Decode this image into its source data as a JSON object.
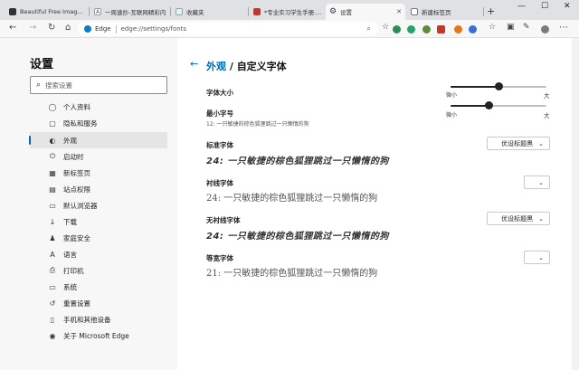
{
  "tabs": [
    {
      "label": "Beautiful Free Images &",
      "active": false
    },
    {
      "label": "一周速抄-互联网精彩内",
      "active": false
    },
    {
      "label": "收藏夹",
      "active": false
    },
    {
      "label": "*专业实习学生手册.pdf",
      "active": false
    },
    {
      "label": "设置",
      "active": true
    },
    {
      "label": "新建标签页",
      "active": false
    }
  ],
  "toolbar": {
    "brand": "Edge",
    "url": "edge://settings/fonts"
  },
  "sidebar": {
    "title": "设置",
    "search_placeholder": "搜索设置",
    "items": [
      {
        "label": "个人资料",
        "icon": "person-icon"
      },
      {
        "label": "隐私和服务",
        "icon": "lock-icon"
      },
      {
        "label": "外观",
        "icon": "appearance-icon",
        "active": true
      },
      {
        "label": "启动时",
        "icon": "power-icon"
      },
      {
        "label": "新标签页",
        "icon": "newtab-icon"
      },
      {
        "label": "站点权限",
        "icon": "permissions-icon"
      },
      {
        "label": "默认浏览器",
        "icon": "browser-icon"
      },
      {
        "label": "下载",
        "icon": "download-icon"
      },
      {
        "label": "家庭安全",
        "icon": "family-icon"
      },
      {
        "label": "语言",
        "icon": "language-icon"
      },
      {
        "label": "打印机",
        "icon": "printer-icon"
      },
      {
        "label": "系统",
        "icon": "system-icon"
      },
      {
        "label": "重置设置",
        "icon": "reset-icon"
      },
      {
        "label": "手机和其他设备",
        "icon": "phone-icon"
      },
      {
        "label": "关于 Microsoft Edge",
        "icon": "edge-logo-icon"
      }
    ]
  },
  "main": {
    "breadcrumb_parent": "外观",
    "breadcrumb_sep": " / ",
    "breadcrumb_current": "自定义字体",
    "font_size": {
      "label": "字体大小",
      "min_label": "微小",
      "max_label": "大",
      "value_fraction": 0.5
    },
    "min_font_size": {
      "label": "最小字号",
      "sample": "12: 一只敏捷的棕色狐狸跳过一只懒惰的狗",
      "min_label": "微小",
      "max_label": "大",
      "value_fraction": 0.4
    },
    "standard_font": {
      "label": "标准字体",
      "sample": "24: 一只敏捷的棕色狐狸跳过一只懒惰的狗",
      "selected": "优设标题黑"
    },
    "serif_font": {
      "label": "衬线字体",
      "sample": "24: 一只敏捷的棕色狐狸跳过一只懒惰的狗",
      "selected": ""
    },
    "sans_font": {
      "label": "无衬线字体",
      "sample": "24: 一只敏捷的棕色狐狸跳过一只懒惰的狗",
      "selected": "优设标题黑"
    },
    "mono_font": {
      "label": "等宽字体",
      "sample": "21: 一只敏捷的棕色狐狸跳过一只懒惰的狗",
      "selected": ""
    }
  },
  "colors": {
    "accent": "#0067b8"
  }
}
